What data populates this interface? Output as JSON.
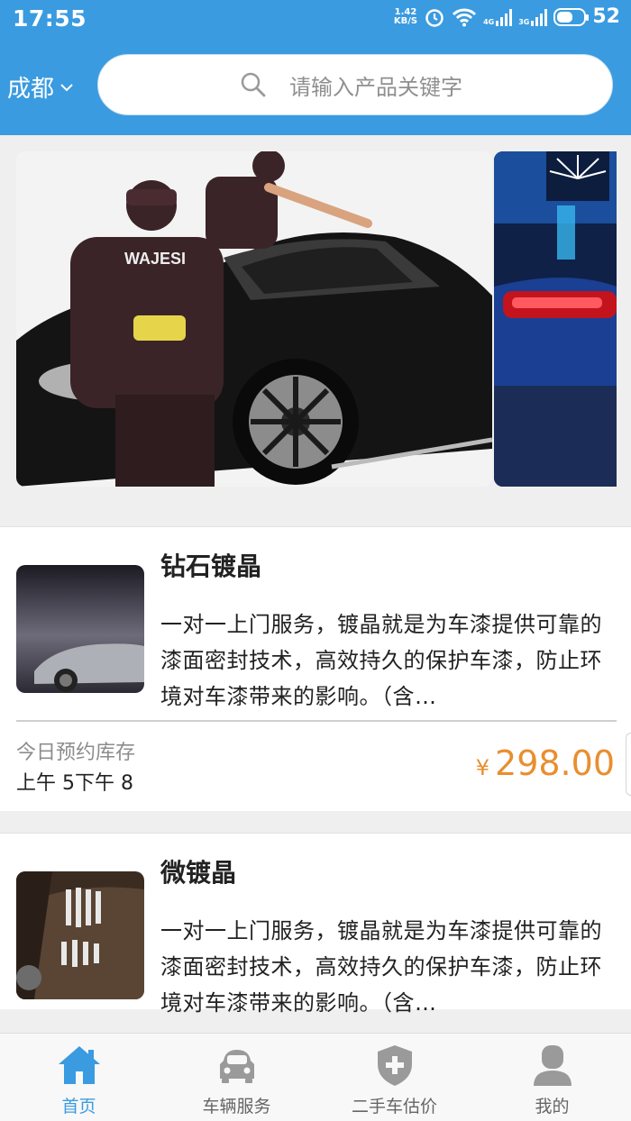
{
  "status_bar": {
    "time": "17:55",
    "speed_value": "1.42",
    "speed_unit": "KB/S",
    "signal1": "4G",
    "signal2": "3G",
    "battery": "52"
  },
  "header": {
    "city": "成都",
    "search_placeholder": "请输入产品关键字"
  },
  "products": [
    {
      "title": "钻石镀晶",
      "description": "一对一上门服务，镀晶就是为车漆提供可靠的漆面密封技术，高效持久的保护车漆，防止环境对车漆带来的影响。（含…",
      "stock_label": "今日预约库存",
      "stock_value": "上午 5下午 8",
      "currency": "¥",
      "price": "298.00"
    },
    {
      "title": "微镀晶",
      "description": "一对一上门服务，镀晶就是为车漆提供可靠的漆面密封技术，高效持久的保护车漆，防止环境对车漆带来的影响。（含…"
    }
  ],
  "banner": {
    "brand_text": "WAJESI"
  },
  "bottom_nav": [
    {
      "label": "首页",
      "icon": "home-icon",
      "active": true
    },
    {
      "label": "车辆服务",
      "icon": "car-icon",
      "active": false
    },
    {
      "label": "二手车估价",
      "icon": "shield-plus-icon",
      "active": false
    },
    {
      "label": "我的",
      "icon": "user-icon",
      "active": false
    }
  ],
  "colors": {
    "primary": "#3a9be0",
    "price": "#e98e2f"
  }
}
